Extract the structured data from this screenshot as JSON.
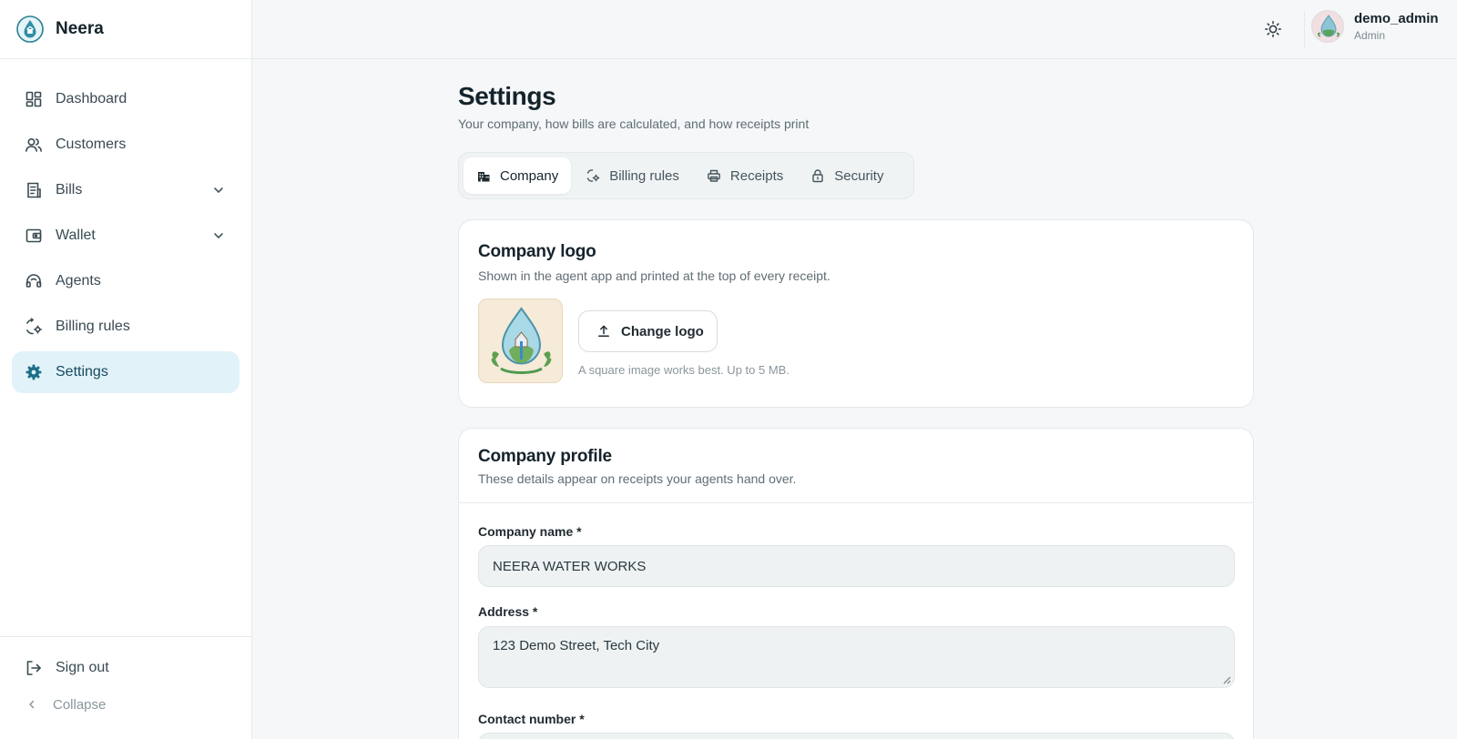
{
  "app": {
    "name": "Neera"
  },
  "sidebar": {
    "items": [
      {
        "label": "Dashboard",
        "icon": "dashboard-icon"
      },
      {
        "label": "Customers",
        "icon": "users-icon"
      },
      {
        "label": "Bills",
        "icon": "receipt-icon",
        "expandable": true
      },
      {
        "label": "Wallet",
        "icon": "wallet-icon",
        "expandable": true
      },
      {
        "label": "Agents",
        "icon": "headset-icon"
      },
      {
        "label": "Billing rules",
        "icon": "rules-icon"
      },
      {
        "label": "Settings",
        "icon": "gear-icon",
        "active": true
      }
    ],
    "sign_out": "Sign out",
    "collapse": "Collapse"
  },
  "header": {
    "user": {
      "name": "demo_admin",
      "role": "Admin"
    }
  },
  "page": {
    "title": "Settings",
    "subtitle": "Your company, how bills are calculated, and how receipts print"
  },
  "tabs": [
    {
      "label": "Company",
      "icon": "building-icon",
      "active": true
    },
    {
      "label": "Billing rules",
      "icon": "rules-icon"
    },
    {
      "label": "Receipts",
      "icon": "printer-icon"
    },
    {
      "label": "Security",
      "icon": "lock-icon"
    }
  ],
  "logo_card": {
    "title": "Company logo",
    "description": "Shown in the agent app and printed at the top of every receipt.",
    "button": "Change logo",
    "hint": "A square image works best. Up to 5 MB."
  },
  "profile_card": {
    "title": "Company profile",
    "description": "These details appear on receipts your agents hand over.",
    "fields": {
      "company_name": {
        "label": "Company name *",
        "value": "NEERA WATER WORKS"
      },
      "address": {
        "label": "Address *",
        "value": "123 Demo Street, Tech City"
      },
      "contact": {
        "label": "Contact number *"
      }
    }
  },
  "colors": {
    "accent": "#1a6f87",
    "active_bg": "#e2f2f9",
    "page_bg": "#f5f7f8"
  }
}
